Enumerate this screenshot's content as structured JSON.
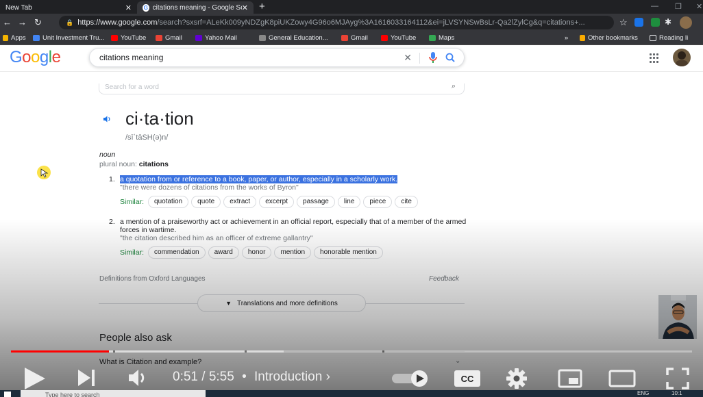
{
  "browser": {
    "tabs": [
      {
        "title": "New Tab",
        "active": false
      },
      {
        "title": "citations meaning - Google Searc",
        "active": true
      }
    ],
    "url_host": "https://www.google.com",
    "url_path": "/search?sxsrf=ALeKk009yNDZgK8piUKZowy4G96o6MJAyg%3A1616033164112&ei=jLVSYNSwBsLr-Qa2lZylCg&q=citations+...",
    "bookmarks": [
      {
        "label": "Apps",
        "color": "#f4b400"
      },
      {
        "label": "Unit Investment Tru...",
        "color": "#4285f4"
      },
      {
        "label": "YouTube",
        "color": "#ff0000"
      },
      {
        "label": "Gmail",
        "color": "#ea4335"
      },
      {
        "label": "Yahoo Mail",
        "color": "#6001d2"
      },
      {
        "label": "General Education...",
        "color": "#888888"
      },
      {
        "label": "Gmail",
        "color": "#ea4335"
      },
      {
        "label": "YouTube",
        "color": "#ff0000"
      },
      {
        "label": "Maps",
        "color": "#34a853"
      }
    ],
    "bookmarks_overflow": "»",
    "other_bookmarks": "Other bookmarks",
    "reading_list": "Reading li"
  },
  "google": {
    "logo": [
      "G",
      "o",
      "o",
      "g",
      "l",
      "e"
    ],
    "logo_colors": [
      "#4285f4",
      "#ea4335",
      "#fbbc05",
      "#4285f4",
      "#34a853",
      "#ea4335"
    ],
    "query": "citations meaning",
    "dict_search_placeholder": "Search for a word"
  },
  "dictionary": {
    "headword": "ci·ta·tion",
    "phonetic": "/sīˈtāSH(ə)n/",
    "part_of_speech": "noun",
    "plural_label": "plural noun: ",
    "plural_value": "citations",
    "senses": [
      {
        "num": "1.",
        "definition": "a quotation from or reference to a book, paper, or author, especially in a scholarly work.",
        "example": "\"there were dozens of citations from the works of Byron\"",
        "similar_label": "Similar:",
        "similar": [
          "quotation",
          "quote",
          "extract",
          "excerpt",
          "passage",
          "line",
          "piece",
          "cite"
        ]
      },
      {
        "num": "2.",
        "definition": "a mention of a praiseworthy act or achievement in an official report, especially that of a member of the armed forces in wartime.",
        "example": "\"the citation described him as an officer of extreme gallantry\"",
        "similar_label": "Similar:",
        "similar": [
          "commendation",
          "award",
          "honor",
          "mention",
          "honorable mention"
        ]
      }
    ],
    "source": "Definitions from Oxford Languages",
    "feedback": "Feedback",
    "translations_button": "Translations and more definitions"
  },
  "people_also_ask": {
    "heading": "People also ask",
    "first_question": "What is Citation and example?"
  },
  "player": {
    "current_time": "0:51",
    "duration": "5:55",
    "separator": "/",
    "chapter": "Introduction",
    "chapter_arrow": "›",
    "progress_fraction": 0.144,
    "cc_label": "CC",
    "accent": "#ff0000"
  },
  "taskbar": {
    "search_placeholder": "Type here to search",
    "language": "ENG",
    "clock": "10:1"
  }
}
